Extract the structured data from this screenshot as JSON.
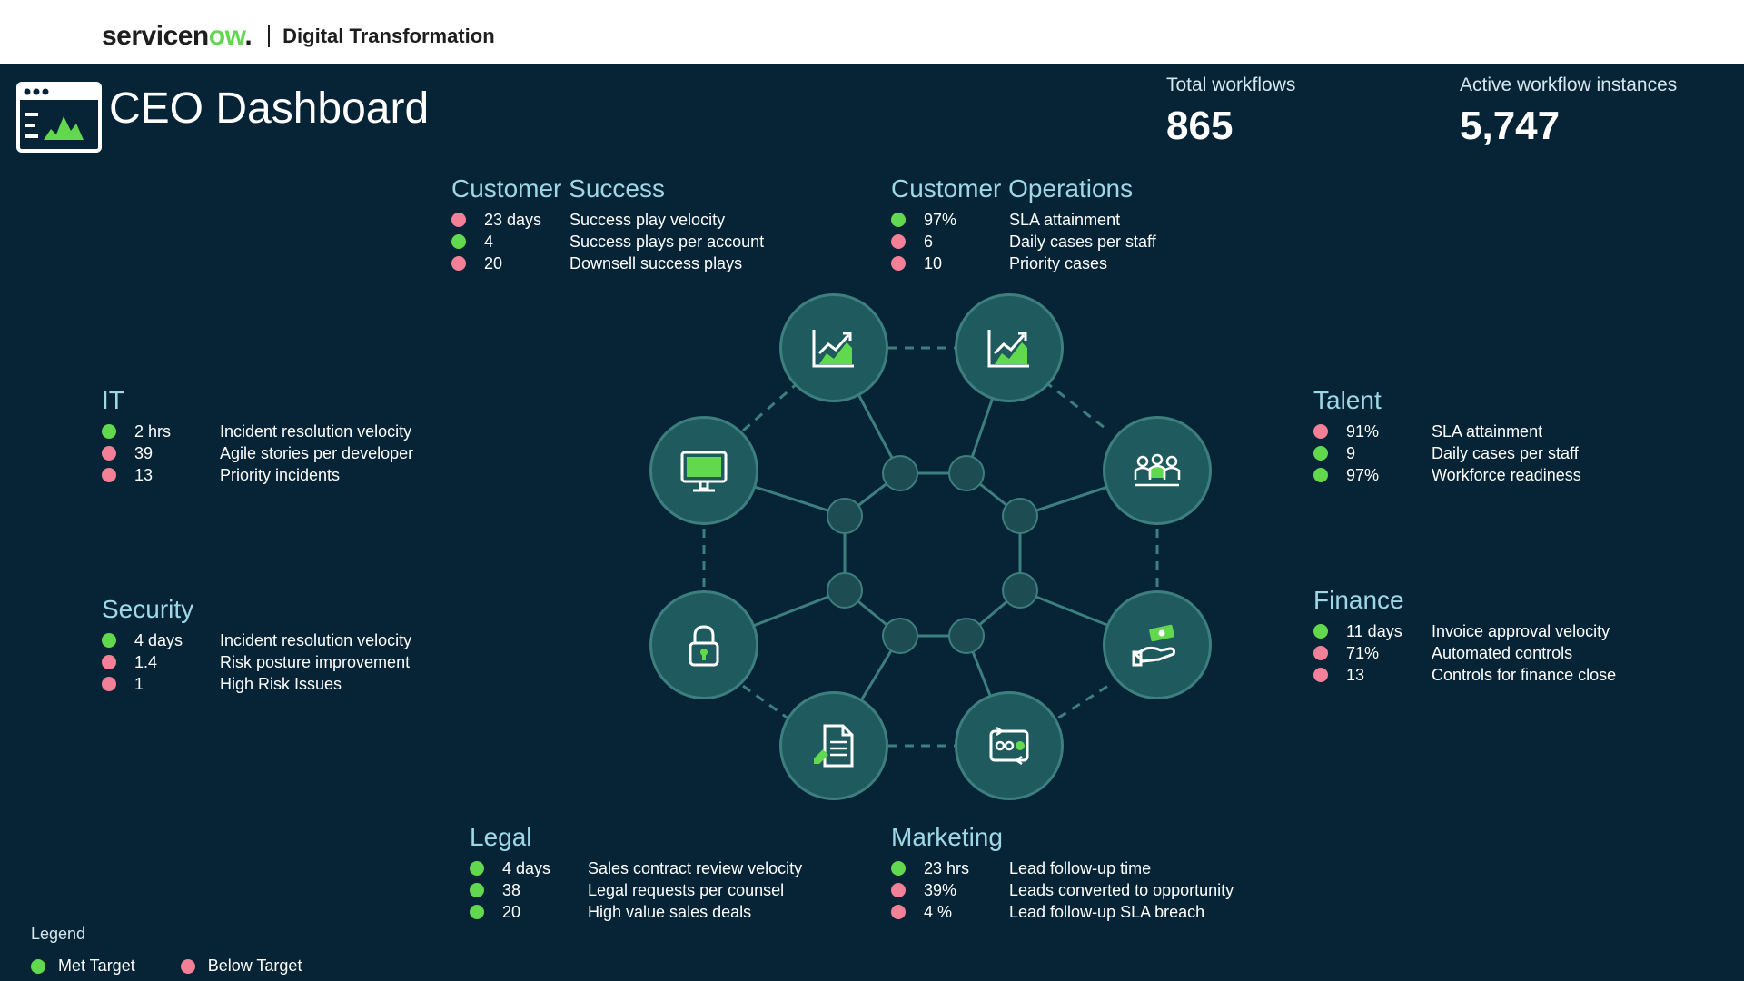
{
  "header": {
    "brand": "servicenow.",
    "subtitle": "Digital Transformation"
  },
  "dashboard": {
    "title": "CEO Dashboard",
    "icon": "dashboard-chart-icon"
  },
  "stats": {
    "total_workflows_label": "Total workflows",
    "total_workflows_value": "865",
    "active_instances_label": "Active workflow instances",
    "active_instances_value": "5,747"
  },
  "groups": {
    "customer_success": {
      "title": "Customer Success",
      "rows": [
        {
          "status": "below",
          "value": "23 days",
          "label": "Success play velocity"
        },
        {
          "status": "met",
          "value": "4",
          "label": "Success plays per account"
        },
        {
          "status": "below",
          "value": "20",
          "label": "Downsell success plays"
        }
      ]
    },
    "customer_operations": {
      "title": "Customer Operations",
      "rows": [
        {
          "status": "met",
          "value": "97%",
          "label": "SLA attainment"
        },
        {
          "status": "below",
          "value": "6",
          "label": "Daily cases per staff"
        },
        {
          "status": "below",
          "value": "10",
          "label": "Priority cases"
        }
      ]
    },
    "it": {
      "title": "IT",
      "rows": [
        {
          "status": "met",
          "value": "2 hrs",
          "label": "Incident resolution velocity"
        },
        {
          "status": "below",
          "value": "39",
          "label": "Agile stories per developer"
        },
        {
          "status": "below",
          "value": "13",
          "label": "Priority incidents"
        }
      ]
    },
    "talent": {
      "title": "Talent",
      "rows": [
        {
          "status": "below",
          "value": "91%",
          "label": "SLA attainment"
        },
        {
          "status": "met",
          "value": "9",
          "label": "Daily cases per staff"
        },
        {
          "status": "met",
          "value": "97%",
          "label": "Workforce readiness"
        }
      ]
    },
    "security": {
      "title": "Security",
      "rows": [
        {
          "status": "met",
          "value": "4 days",
          "label": "Incident resolution velocity"
        },
        {
          "status": "below",
          "value": "1.4",
          "label": "Risk posture improvement"
        },
        {
          "status": "below",
          "value": "1",
          "label": "High Risk Issues"
        }
      ]
    },
    "finance": {
      "title": "Finance",
      "rows": [
        {
          "status": "met",
          "value": "11 days",
          "label": "Invoice approval velocity"
        },
        {
          "status": "below",
          "value": "71%",
          "label": "Automated controls"
        },
        {
          "status": "below",
          "value": "13",
          "label": "Controls for finance close"
        }
      ]
    },
    "legal": {
      "title": "Legal",
      "rows": [
        {
          "status": "met",
          "value": "4 days",
          "label": "Sales contract review velocity"
        },
        {
          "status": "met",
          "value": "38",
          "label": "Legal requests per counsel"
        },
        {
          "status": "met",
          "value": "20",
          "label": "High value sales deals"
        }
      ]
    },
    "marketing": {
      "title": "Marketing",
      "rows": [
        {
          "status": "met",
          "value": "23 hrs",
          "label": "Lead follow-up time"
        },
        {
          "status": "below",
          "value": "39%",
          "label": "Leads converted to opportunity"
        },
        {
          "status": "below",
          "value": "4 %",
          "label": "Lead follow-up SLA breach"
        }
      ]
    }
  },
  "network_icons": [
    "chart-up-icon",
    "chart-up-icon",
    "monitor-icon",
    "team-icon",
    "lock-icon",
    "money-hand-icon",
    "document-edit-icon",
    "workflow-icon"
  ],
  "legend": {
    "title": "Legend",
    "met_label": "Met Target",
    "below_label": "Below Target"
  },
  "colors": {
    "background": "#062436",
    "met": "#62d84e",
    "below": "#f48098",
    "group_title": "#9ed7e6",
    "node_fill": "#1f5a5e"
  }
}
